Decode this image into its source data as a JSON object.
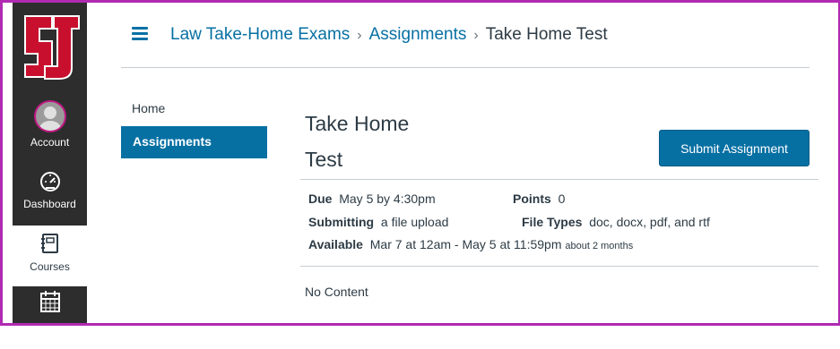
{
  "global_nav": {
    "logo_text": "SU",
    "items": [
      {
        "label": "Account",
        "icon": "avatar"
      },
      {
        "label": "Dashboard",
        "icon": "speedometer-icon"
      },
      {
        "label": "Courses",
        "icon": "book-icon"
      },
      {
        "label": "",
        "icon": "calendar-icon"
      }
    ]
  },
  "breadcrumb": {
    "course": "Law Take-Home Exams",
    "section": "Assignments",
    "current": "Take Home Test",
    "separator": "›"
  },
  "course_nav": {
    "items": [
      {
        "label": "Home",
        "active": false
      },
      {
        "label": "Assignments",
        "active": true
      }
    ]
  },
  "assignment": {
    "title_line1": "Take Home",
    "title_line2": "Test",
    "submit_label": "Submit Assignment",
    "due_label": "Due",
    "due_value": "May 5 by 4:30pm",
    "points_label": "Points",
    "points_value": "0",
    "submitting_label": "Submitting",
    "submitting_value": "a file upload",
    "filetypes_label": "File Types",
    "filetypes_value": "doc, docx, pdf, and rtf",
    "available_label": "Available",
    "available_value": "Mar 7 at 12am - May 5 at 11:59pm",
    "available_note": "about 2 months",
    "content": "No Content"
  },
  "colors": {
    "accent": "#0770a3",
    "nav_bg": "#2d2d2d",
    "frame": "#b02ab2",
    "logo_red": "#c8102e"
  }
}
